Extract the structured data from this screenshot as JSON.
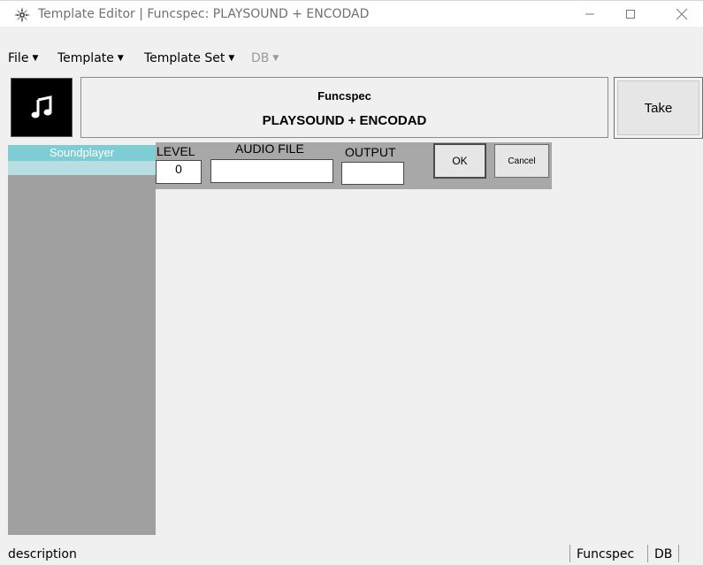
{
  "window": {
    "title": "Template Editor | Funcspec: PLAYSOUND + ENCODAD",
    "controls": [
      "minimize",
      "maximize",
      "close"
    ]
  },
  "menu": {
    "items": [
      {
        "label": "File"
      },
      {
        "label": "Template"
      },
      {
        "label": "Template Set"
      },
      {
        "label": "DB"
      }
    ]
  },
  "header": {
    "icon": "music-note-icon",
    "title": "Funcspec",
    "subtitle": "PLAYSOUND + ENCODAD",
    "take_label": "Take"
  },
  "sidebar": {
    "items": [
      {
        "label": "Soundplayer"
      }
    ]
  },
  "form": {
    "level_label": "LEVEL",
    "level_value": "0",
    "audio_label": "AUDIO FILE",
    "audio_value": "",
    "output_label": "OUTPUT",
    "output_value": "",
    "ok_label": "OK",
    "cancel_label": "Cancel"
  },
  "status": {
    "description": "description",
    "segments": [
      "Funcspec",
      "DB"
    ]
  },
  "colors": {
    "sidebar_item": "#7fcdd4",
    "sidebar_bg": "#a0a0a0",
    "form_panel": "#a8a8a8"
  }
}
